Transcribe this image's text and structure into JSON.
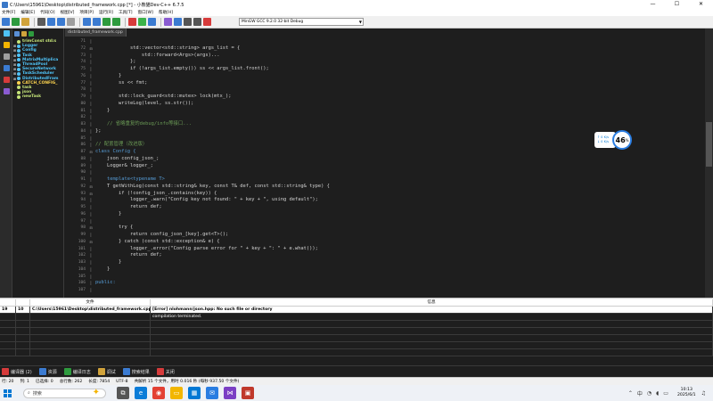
{
  "window": {
    "title": "C:\\Users\\15961\\Desktop\\distributed_framework.cpp [*] - 小熊猫Dev-C++ 6.7.5",
    "controls": [
      "—",
      "☐",
      "✕"
    ]
  },
  "menu": [
    "文件[F]",
    "编辑[E]",
    "代码[O]",
    "视图[V]",
    "项目[P]",
    "运行[R]",
    "工具[T]",
    "窗口[W]",
    "帮助[H]"
  ],
  "toolbar": {
    "compiler": "MinGW GCC 9.2.0 32-bit Debug",
    "button_colors": [
      "#3b7bd1",
      "#2e9b3e",
      "#d1a33b",
      "#5a5a5a",
      "#3b7bd1",
      "#3b7bd1",
      "#9e9e9e",
      "#3b7bd1",
      "#3b7bd1",
      "#2e9b3e",
      "#2e9b3e",
      "#d63b3b",
      "#3bb34a",
      "#3b7bd1",
      "#8a5bd1",
      "#3b7bd1",
      "#555555",
      "#555555",
      "#d63b3b"
    ]
  },
  "class_browser": {
    "items": [
      {
        "label": "trimConst std:s",
        "kind": "fn"
      },
      {
        "label": "Logger",
        "kind": "cls"
      },
      {
        "label": "Config",
        "kind": "cls"
      },
      {
        "label": "Task",
        "kind": "cls"
      },
      {
        "label": "MatrixMultiplica",
        "kind": "cls"
      },
      {
        "label": "ThreadPool",
        "kind": "cls"
      },
      {
        "label": "SecureNetwork",
        "kind": "cls"
      },
      {
        "label": "TaskScheduler",
        "kind": "cls"
      },
      {
        "label": "DistributedFram",
        "kind": "cls"
      },
      {
        "label": "CATCH_CONFIG_",
        "kind": "macro"
      },
      {
        "label": "task",
        "kind": "fn"
      },
      {
        "label": "json",
        "kind": "fn"
      },
      {
        "label": "newTask",
        "kind": "fn"
      }
    ]
  },
  "editor": {
    "tab": "distributed_framework.cpp",
    "line_start": 71,
    "lines": [
      {
        "t": "",
        "c": ""
      },
      {
        "t": "            std::vector<std::string> args_list = {",
        "c": ""
      },
      {
        "t": "                std::forward<Args>(args)...",
        "c": ""
      },
      {
        "t": "            };",
        "c": ""
      },
      {
        "t": "            if (!args_list.empty()) ss << args_list.front();",
        "c": ""
      },
      {
        "t": "        }",
        "c": ""
      },
      {
        "t": "        ss << fmt;",
        "c": ""
      },
      {
        "t": "",
        "c": ""
      },
      {
        "t": "        std::lock_guard<std::mutex> lock(mtx_);",
        "c": ""
      },
      {
        "t": "        writeLog(level, ss.str());",
        "c": ""
      },
      {
        "t": "    }",
        "c": ""
      },
      {
        "t": "",
        "c": ""
      },
      {
        "t": "    // 省略重复的debug/info等接口...",
        "c": "cm"
      },
      {
        "t": "};",
        "c": ""
      },
      {
        "t": "",
        "c": ""
      },
      {
        "t": "// 配置管理（改进版）",
        "c": "cm"
      },
      {
        "t": "class Config {",
        "c": "kw"
      },
      {
        "t": "    json config_json_;",
        "c": ""
      },
      {
        "t": "    Logger& logger_;",
        "c": ""
      },
      {
        "t": "",
        "c": ""
      },
      {
        "t": "    template<typename T>",
        "c": "kw"
      },
      {
        "t": "    T getWithLog(const std::string& key, const T& def, const std::string& type) {",
        "c": ""
      },
      {
        "t": "        if (!config_json_.contains(key)) {",
        "c": ""
      },
      {
        "t": "            logger_.warn(\"Config key not found: \" + key + \", using default\");",
        "c": ""
      },
      {
        "t": "            return def;",
        "c": ""
      },
      {
        "t": "        }",
        "c": ""
      },
      {
        "t": "",
        "c": ""
      },
      {
        "t": "        try {",
        "c": ""
      },
      {
        "t": "            return config_json_[key].get<T>();",
        "c": ""
      },
      {
        "t": "        } catch (const std::exception& e) {",
        "c": ""
      },
      {
        "t": "            logger_.error(\"Config parse error for \" + key + \": \" + e.what());",
        "c": ""
      },
      {
        "t": "            return def;",
        "c": ""
      },
      {
        "t": "        }",
        "c": ""
      },
      {
        "t": "    }",
        "c": ""
      },
      {
        "t": "",
        "c": ""
      },
      {
        "t": "public:",
        "c": "kw"
      },
      {
        "t": "",
        "c": ""
      }
    ]
  },
  "overlay": {
    "pill1": "↑ 0  K/s",
    "pill2": "↓ 0  K/s",
    "value": "46",
    "unit": "%"
  },
  "messages": {
    "headers": [
      "",
      "",
      "文件",
      "信息"
    ],
    "rows": [
      {
        "line": "19",
        "col": "10",
        "file": "C:\\Users\\15961\\Desktop\\distributed_framework.cpp",
        "msg": "[Error] nlohmann/json.hpp: No such file or directory"
      },
      {
        "line": "",
        "col": "",
        "file": "",
        "msg": "compilation terminated."
      }
    ]
  },
  "bottom_tabs": [
    {
      "label": "编译器 (2)",
      "color": "#d63b3b"
    },
    {
      "label": "资源",
      "color": "#3b7bd1"
    },
    {
      "label": "编译日志",
      "color": "#2e9b3e"
    },
    {
      "label": "调试",
      "color": "#d1a33b"
    },
    {
      "label": "搜索结果",
      "color": "#3b7bd1"
    },
    {
      "label": "关闭",
      "color": "#d63b3b"
    }
  ],
  "status": {
    "line": "行: 20",
    "col": "列: 1",
    "selected": "已选择: 0",
    "total": "总行数: 262",
    "length": "长度: 7854",
    "encoding": "UTF-8",
    "parse": "共解析 15 个文件，用时 0.016 秒 (每秒 937.50 个文件)"
  },
  "taskbar": {
    "search": "搜索",
    "time": "10:13",
    "date": "2025/6/1",
    "apps": [
      {
        "icon": "task-view-icon",
        "color": "#555555",
        "glyph": "⧉"
      },
      {
        "icon": "edge-icon",
        "color": "#0a7cd8",
        "glyph": "e"
      },
      {
        "icon": "chrome-icon",
        "color": "#e34133",
        "glyph": "◉"
      },
      {
        "icon": "explorer-icon",
        "color": "#f2b600",
        "glyph": "▭"
      },
      {
        "icon": "store-icon",
        "color": "#0078d4",
        "glyph": "▦"
      },
      {
        "icon": "mail-icon",
        "color": "#2a7de1",
        "glyph": "✉"
      },
      {
        "icon": "vs-icon",
        "color": "#7b3fc4",
        "glyph": "⋈"
      },
      {
        "icon": "devcpp-icon",
        "color": "#c0392b",
        "glyph": "▣"
      }
    ]
  }
}
